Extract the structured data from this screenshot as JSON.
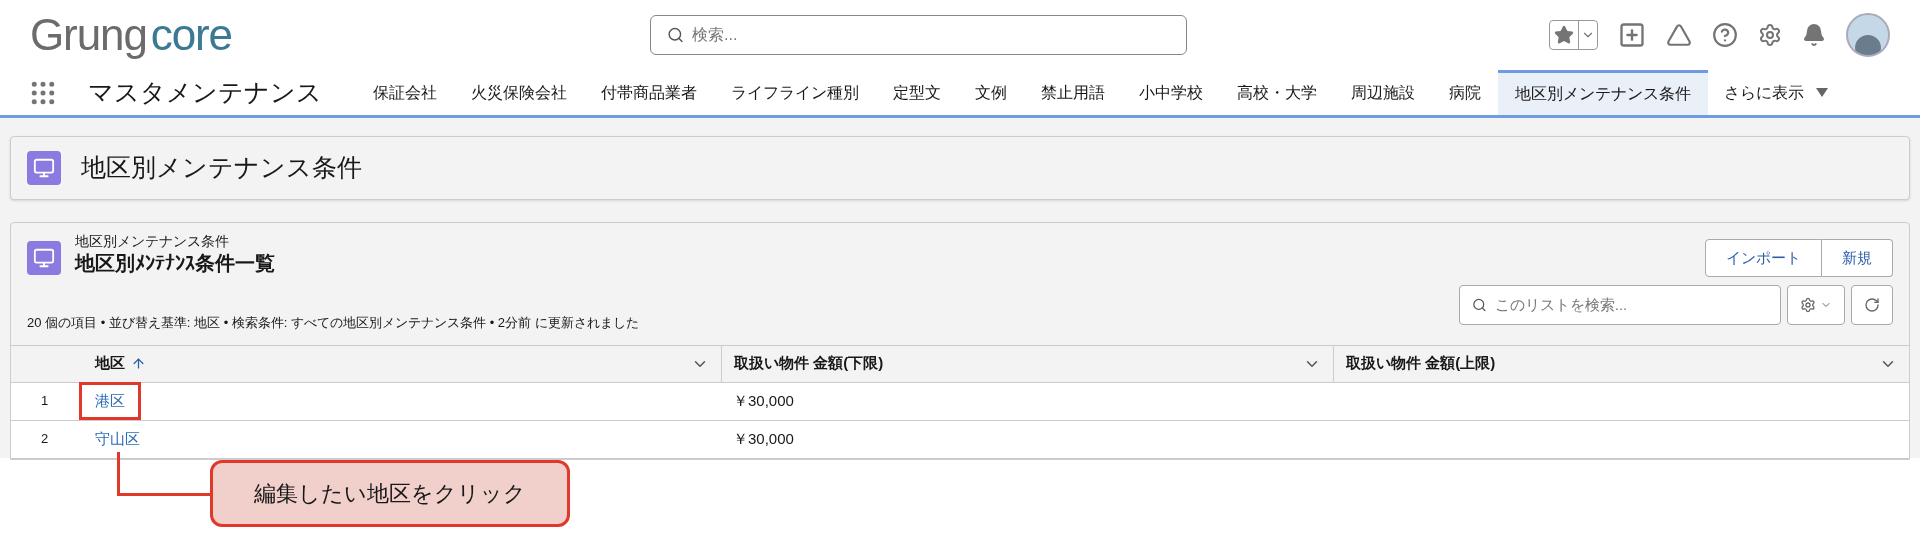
{
  "header": {
    "logo": [
      "Grung",
      "core"
    ],
    "search": {
      "placeholder": "検索..."
    }
  },
  "nav": {
    "app_name": "マスタメンテナンス",
    "tabs": [
      {
        "label": "保証会社",
        "selected": false
      },
      {
        "label": "火災保険会社",
        "selected": false
      },
      {
        "label": "付帯商品業者",
        "selected": false
      },
      {
        "label": "ライフライン種別",
        "selected": false
      },
      {
        "label": "定型文",
        "selected": false
      },
      {
        "label": "文例",
        "selected": false
      },
      {
        "label": "禁止用語",
        "selected": false
      },
      {
        "label": "小中学校",
        "selected": false
      },
      {
        "label": "高校・大学",
        "selected": false
      },
      {
        "label": "周辺施設",
        "selected": false
      },
      {
        "label": "病院",
        "selected": false
      },
      {
        "label": "地区別メンテナンス条件",
        "selected": true
      }
    ],
    "more": "さらに表示"
  },
  "page_header": {
    "title": "地区別メンテナンス条件"
  },
  "list": {
    "object_name": "地区別メンテナンス条件",
    "title": "地区別ﾒﾝﾃﾅﾝｽ条件一覧",
    "buttons": [
      "インポート",
      "新規"
    ],
    "summary": "20 個の項目 • 並び替え基準: 地区 • 検索条件: すべての地区別メンテナンス条件 • 2分前 に更新されました",
    "search": {
      "placeholder": "このリストを検索..."
    },
    "columns": [
      {
        "label": "地区",
        "sorted": true
      },
      {
        "label": "取扱い物件 金額(下限)",
        "sorted": false
      },
      {
        "label": "取扱い物件 金額(上限)",
        "sorted": false
      }
    ],
    "rows": [
      {
        "number": "1",
        "district": "港区",
        "min": "￥30,000",
        "highlighted": true
      },
      {
        "number": "2",
        "district": "守山区",
        "min": "￥30,000",
        "highlighted": false
      }
    ]
  },
  "annotation": {
    "text": "編集したい地区をクリック"
  }
}
